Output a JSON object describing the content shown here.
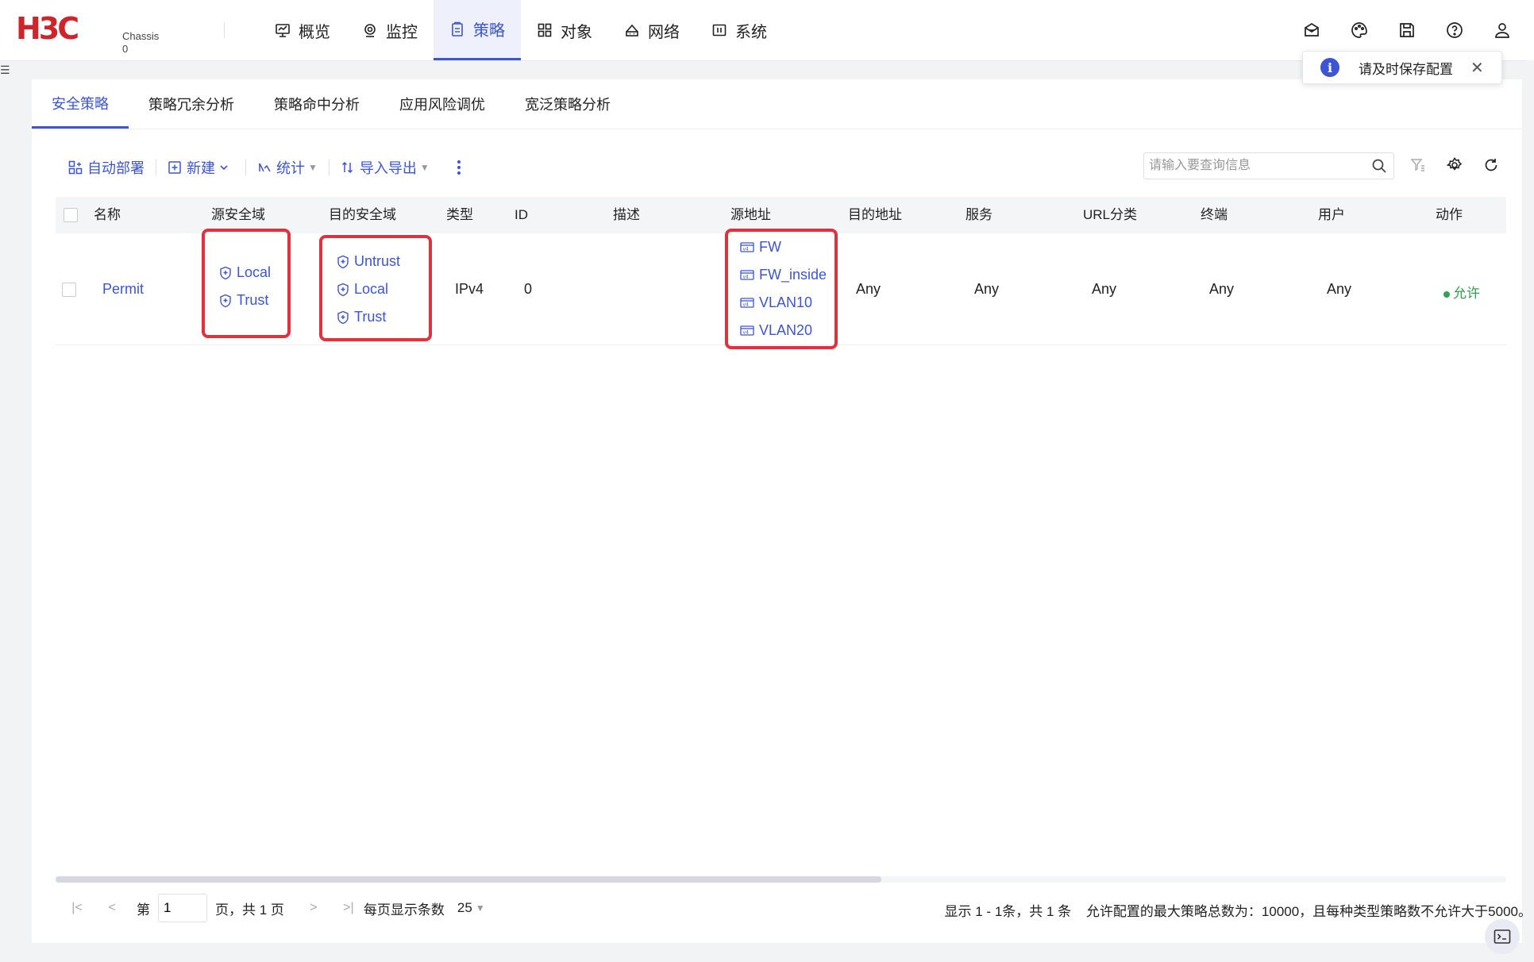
{
  "brand": {
    "logo": "H3C",
    "chassis_line1": "Chassis",
    "chassis_line2": "0"
  },
  "nav": [
    {
      "label": "概览",
      "icon": "dashboard-icon"
    },
    {
      "label": "监控",
      "icon": "monitor-icon"
    },
    {
      "label": "策略",
      "icon": "clipboard-icon",
      "active": true
    },
    {
      "label": "对象",
      "icon": "grid-icon"
    },
    {
      "label": "网络",
      "icon": "network-icon"
    },
    {
      "label": "系统",
      "icon": "system-icon"
    }
  ],
  "toast": {
    "text": "请及时保存配置"
  },
  "tabs": [
    "安全策略",
    "策略冗余分析",
    "策略命中分析",
    "应用风险调优",
    "宽泛策略分析"
  ],
  "toolbar": {
    "auto_deploy": "自动部署",
    "new": "新建",
    "stats": "统计",
    "import_export": "导入导出"
  },
  "search": {
    "placeholder": "请输入要查询信息"
  },
  "table": {
    "columns": [
      "名称",
      "源安全域",
      "目的安全域",
      "类型",
      "ID",
      "描述",
      "源地址",
      "目的地址",
      "服务",
      "URL分类",
      "终端",
      "用户",
      "动作"
    ],
    "rows": [
      {
        "name": "Permit",
        "src_zones": [
          "Local",
          "Trust"
        ],
        "dst_zones": [
          "Untrust",
          "Local",
          "Trust"
        ],
        "type": "IPv4",
        "id": "0",
        "description": "",
        "src_addr": [
          "FW",
          "FW_inside",
          "VLAN10",
          "VLAN20"
        ],
        "dst_addr": "Any",
        "service": "Any",
        "url_category": "Any",
        "terminal": "Any",
        "user": "Any",
        "action": "允许"
      }
    ]
  },
  "pager": {
    "page_prefix": "第",
    "page_value": "1",
    "page_suffix": "页，共 1 页",
    "per_page_label": "每页显示条数",
    "per_page_value": "25",
    "summary": "显示 1 - 1条，共 1 条",
    "limit_note": "允许配置的最大策略总数为：10000，且每种类型策略数不允许大于5000。"
  },
  "colors": {
    "accent": "#3b55d6",
    "brand_red": "#d0242b",
    "highlight_red": "#e3303f",
    "allow_green": "#2ea44f"
  }
}
